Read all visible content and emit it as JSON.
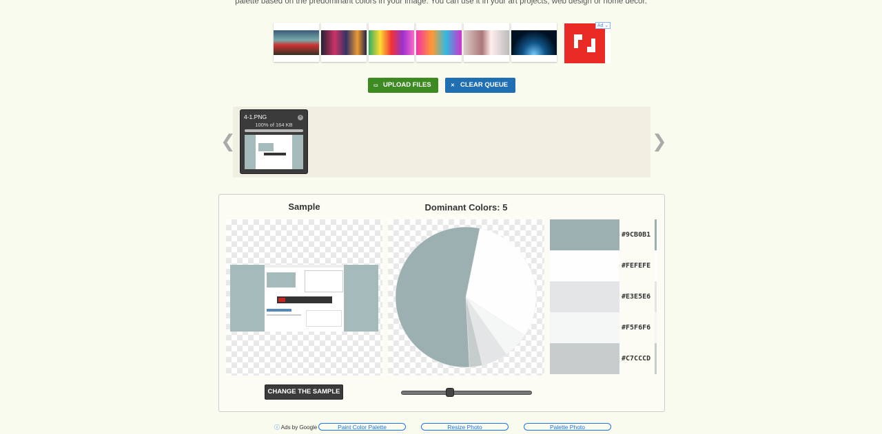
{
  "intro": "palette based on the predominant colors in your image. You can use it in your art projects, web design or home decor.",
  "ad": {
    "badge": "Ad ⌄"
  },
  "buttons": {
    "upload": "UPLOAD FILES",
    "clear": "CLEAR QUEUE",
    "change_sample": "CHANGE THE SAMPLE"
  },
  "queue": {
    "prev": "❮",
    "next": "❯",
    "file": {
      "name": "4-1.PNG",
      "status": "100% of 164 KB",
      "progress": 1.0
    }
  },
  "panel": {
    "sample_heading": "Sample",
    "dominant_heading": "Dominant Colors: 5"
  },
  "colors": [
    {
      "hex": "#9CB0B1",
      "label": "#9CB0B1",
      "share": 0.54
    },
    {
      "hex": "#FEFEFE",
      "label": "#FEFEFE",
      "share": 0.31
    },
    {
      "hex": "#E3E5E6",
      "label": "#E3E5E6",
      "share": 0.06
    },
    {
      "hex": "#F5F6F6",
      "label": "#F5F6F6",
      "share": 0.06
    },
    {
      "hex": "#C7CCCD",
      "label": "#C7CCCD",
      "share": 0.03
    }
  ],
  "slider": {
    "value": 5
  },
  "ads_footer": {
    "ads_by": "Ads by Google",
    "links": [
      "Paint Color Palette",
      "Resize Photo",
      "Palette Photo"
    ]
  }
}
